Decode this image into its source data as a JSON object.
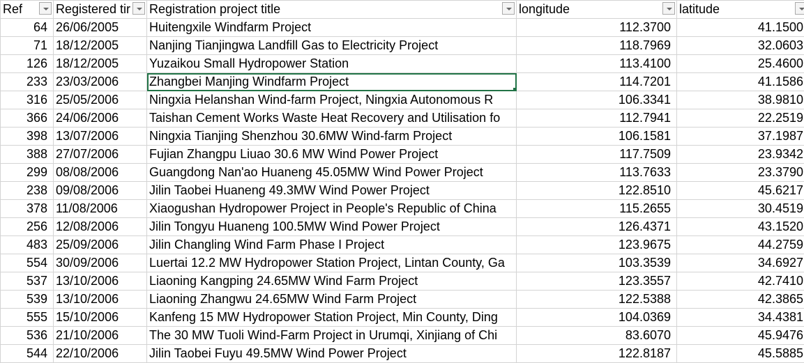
{
  "headers": [
    "Ref",
    "Registered tir",
    "Registration project title",
    "longitude",
    "latitude"
  ],
  "rows": [
    [
      "64",
      "26/06/2005",
      "Huitengxile Windfarm Project",
      "112.3700",
      "41.1500"
    ],
    [
      "71",
      "18/12/2005",
      "Nanjing Tianjingwa Landfill Gas to Electricity Project",
      "118.7969",
      "32.0603"
    ],
    [
      "126",
      "18/12/2005",
      "Yuzaikou Small Hydropower Station",
      "113.4100",
      "25.4600"
    ],
    [
      "233",
      "23/03/2006",
      "Zhangbei Manjing Windfarm Project",
      "114.7201",
      "41.1586"
    ],
    [
      "316",
      "25/05/2006",
      "Ningxia Helanshan Wind-farm Project, Ningxia Autonomous R",
      "106.3341",
      "38.9810"
    ],
    [
      "366",
      "24/06/2006",
      "Taishan Cement Works Waste Heat Recovery and Utilisation fo",
      "112.7941",
      "22.2519"
    ],
    [
      "398",
      "13/07/2006",
      "Ningxia Tianjing Shenzhou 30.6MW Wind-farm Project",
      "106.1581",
      "37.1987"
    ],
    [
      "388",
      "27/07/2006",
      "Fujian Zhangpu Liuao 30.6 MW Wind Power Project",
      "117.7509",
      "23.9342"
    ],
    [
      "299",
      "08/08/2006",
      "Guangdong Nan'ao Huaneng 45.05MW Wind Power Project",
      "113.7633",
      "23.3790"
    ],
    [
      "238",
      "09/08/2006",
      "Jilin Taobei Huaneng 49.3MW Wind Power Project",
      "122.8510",
      "45.6217"
    ],
    [
      "378",
      "11/08/2006",
      "Xiaogushan Hydropower Project in People's Republic of China",
      "115.2655",
      "30.4519"
    ],
    [
      "256",
      "12/08/2006",
      "Jilin Tongyu Huaneng 100.5MW Wind Power Project",
      "126.4371",
      "43.1520"
    ],
    [
      "483",
      "25/09/2006",
      "Jilin Changling Wind Farm Phase I Project",
      "123.9675",
      "44.2759"
    ],
    [
      "554",
      "30/09/2006",
      "Luertai 12.2 MW Hydropower Station Project, Lintan County, Ga",
      "103.3539",
      "34.6927"
    ],
    [
      "537",
      "13/10/2006",
      "Liaoning Kangping 24.65MW Wind Farm Project",
      "123.3557",
      "42.7410"
    ],
    [
      "539",
      "13/10/2006",
      "Liaoning Zhangwu 24.65MW Wind Farm Project",
      "122.5388",
      "42.3865"
    ],
    [
      "555",
      "15/10/2006",
      "Kanfeng 15 MW Hydropower Station Project, Min County, Ding",
      "104.0369",
      "34.4381"
    ],
    [
      "536",
      "21/10/2006",
      "The 30 MW Tuoli Wind-Farm Project in Urumqi, Xinjiang of Chi",
      "83.6070",
      "45.9476"
    ],
    [
      "544",
      "22/10/2006",
      "Jilin Taobei Fuyu 49.5MW Wind Power Project",
      "122.8187",
      "45.5885"
    ]
  ]
}
